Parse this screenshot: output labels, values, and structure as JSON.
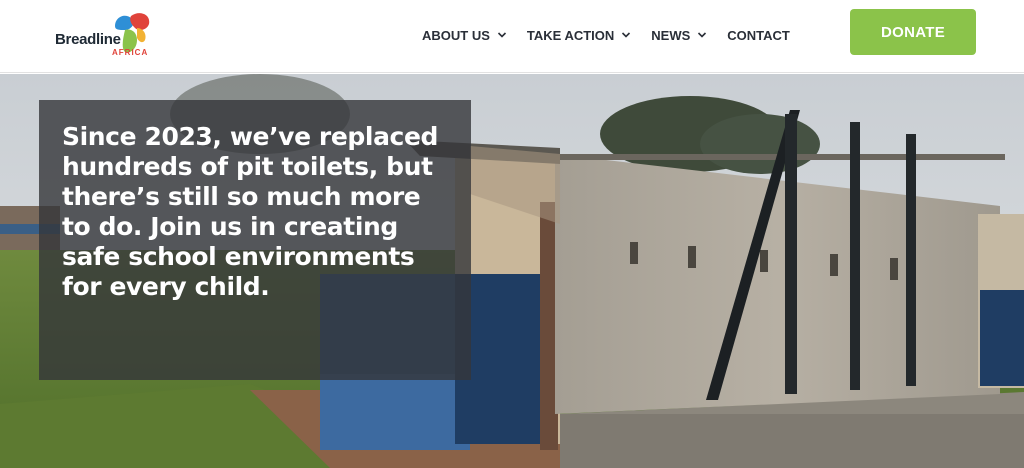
{
  "brand": {
    "name": "Breadline",
    "sub": "AFRICA",
    "logo_icon": "breadline-africa-logo",
    "colors": {
      "blue": "#2e8fd6",
      "red": "#e0433a",
      "green": "#8bc34a",
      "yellow": "#f2b233"
    }
  },
  "nav": {
    "items": [
      {
        "label": "ABOUT US",
        "has_dropdown": true
      },
      {
        "label": "TAKE ACTION",
        "has_dropdown": true
      },
      {
        "label": "NEWS",
        "has_dropdown": true
      },
      {
        "label": "CONTACT",
        "has_dropdown": false
      }
    ]
  },
  "donate": {
    "label": "DONATE",
    "color": "#8bc34a"
  },
  "hero": {
    "headline": "Since 2023, we’ve replaced hundreds of pit toilets, but there’s still so much more to do. Join us in creating safe school environments for every child."
  }
}
